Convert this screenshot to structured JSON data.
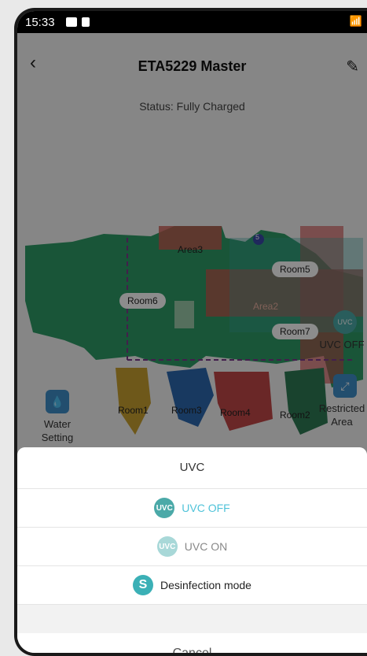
{
  "status_bar": {
    "time": "15:33"
  },
  "header": {
    "title": "ETA5229 Master"
  },
  "status_text": "Status: Fully Charged",
  "map": {
    "rooms": [
      "Room1",
      "Room2",
      "Room3",
      "Room4",
      "Room5",
      "Room6",
      "Room7"
    ],
    "areas": [
      "Area3",
      "Area2"
    ],
    "dock_number": "5"
  },
  "side_controls": {
    "water_setting": "Water\nSetting",
    "uvc_toggle": "UVC OFF",
    "restricted_area": "Restricted\nArea"
  },
  "sheet": {
    "title": "UVC",
    "options": [
      {
        "label": "UVC OFF",
        "icon": "UVC",
        "color": "#4fc3d9",
        "icon_bg": "#4ba9a8"
      },
      {
        "label": "UVC ON",
        "icon": "UVC",
        "color": "#888888",
        "icon_bg": "#a8d8d8"
      },
      {
        "label": "Desinfection mode",
        "icon": "S",
        "color": "#222222",
        "icon_bg": "#3bb0b6"
      }
    ],
    "cancel": "Cancel"
  }
}
